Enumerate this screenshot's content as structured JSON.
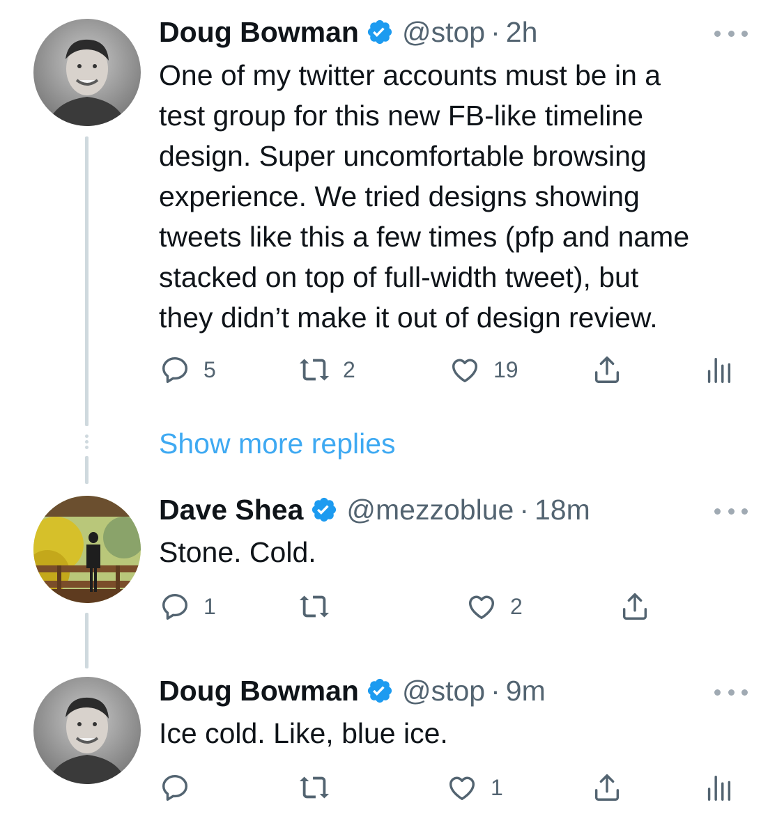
{
  "tweets": [
    {
      "name": "Doug Bowman",
      "handle": "@stop",
      "separator": "·",
      "time": "2h",
      "lines": [
        "One of my twitter accounts must be in a",
        "test group for this new FB-like timeline",
        "design. Super uncomfortable browsing",
        "experience. We tried designs showing",
        "tweets like this a few times (pfp and name",
        "stacked on top of full-width tweet), but",
        "they didn’t make it out of design review."
      ],
      "replies": "5",
      "retweets": "2",
      "likes": "19"
    },
    {
      "name": "Dave Shea",
      "handle": "@mezzoblue",
      "separator": "·",
      "time": "18m",
      "lines": [
        "Stone. Cold."
      ],
      "replies": "1",
      "retweets": "",
      "likes": "2"
    },
    {
      "name": "Doug Bowman",
      "handle": "@stop",
      "separator": "·",
      "time": "9m",
      "lines": [
        "Ice cold. Like, blue ice."
      ],
      "replies": "",
      "retweets": "",
      "likes": "1"
    }
  ],
  "show_more_replies": "Show more replies",
  "icons": {
    "reply": "reply-icon",
    "retweet": "retweet-icon",
    "like": "heart-icon",
    "share": "share-icon",
    "analytics": "analytics-icon",
    "verified": "verified-badge-icon",
    "more": "more-icon"
  },
  "colors": {
    "text": "#0f1419",
    "secondary": "#536471",
    "link": "#1d9bf0",
    "verified": "#1d9bf0",
    "thread_line": "#cfd9de"
  }
}
